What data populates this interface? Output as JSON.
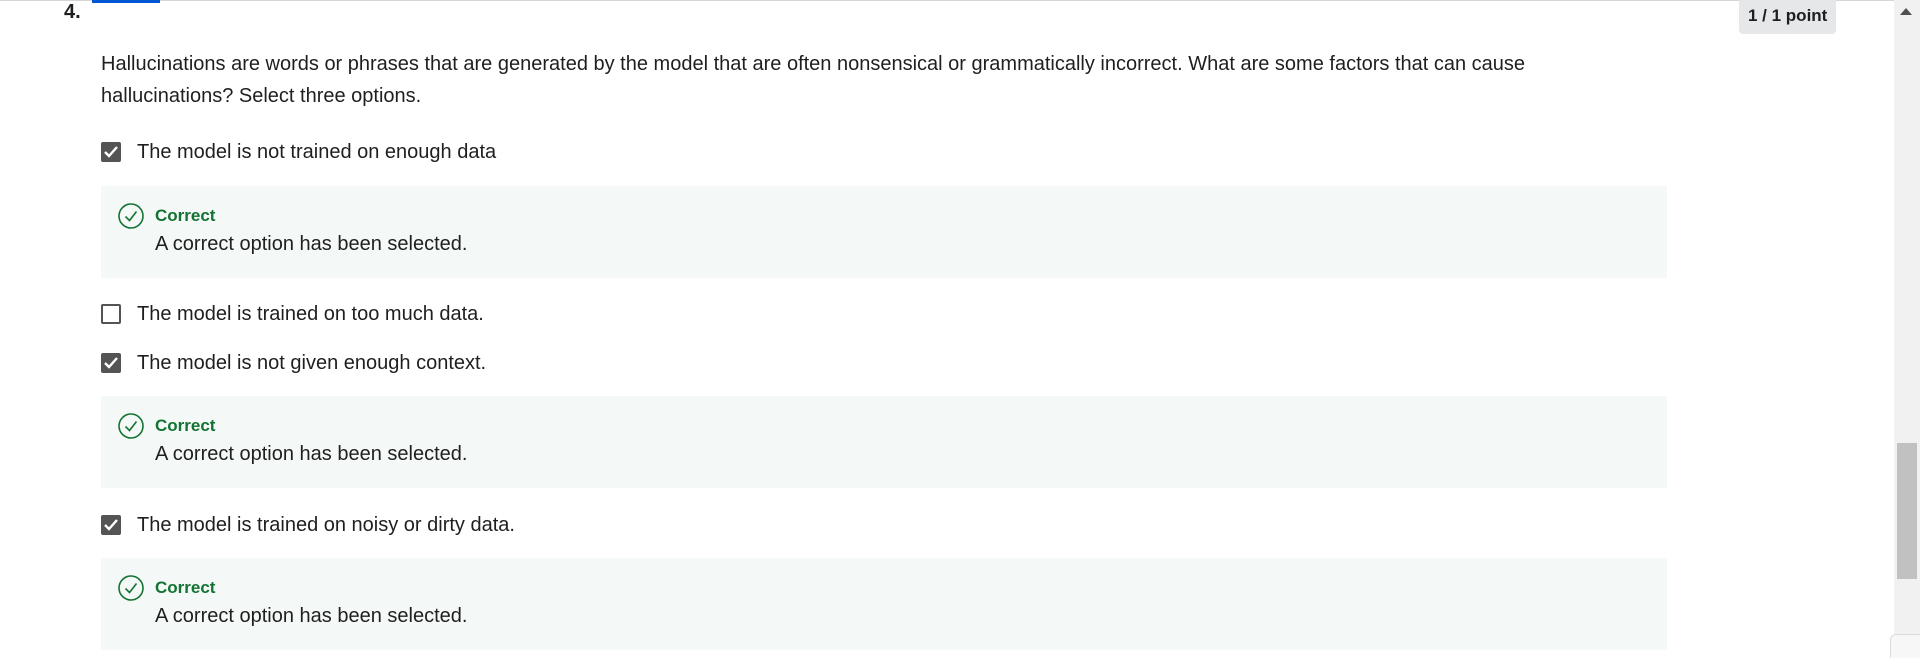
{
  "question": {
    "number": "4.",
    "score": "1 / 1 point",
    "prompt": "Hallucinations are words or phrases that are generated by the model that are often nonsensical or grammatically incorrect. What are some factors that can cause hallucinations? Select three options.",
    "options": [
      {
        "label": "The model is not trained on enough data",
        "checked": true,
        "feedback": {
          "status": "Correct",
          "text": "A correct option has been selected."
        }
      },
      {
        "label": "The model is trained on too much data.",
        "checked": false
      },
      {
        "label": "The model is not given enough context.",
        "checked": true,
        "feedback": {
          "status": "Correct",
          "text": "A correct option has been selected."
        }
      },
      {
        "label": "The model is trained on noisy or dirty data.",
        "checked": true,
        "feedback": {
          "status": "Correct",
          "text": "A correct option has been selected."
        }
      }
    ]
  },
  "colors": {
    "correct": "#137333",
    "checkbox": "#545454",
    "feedback_bg": "#f4f8f6",
    "score_badge_bg": "#e5e7e8"
  },
  "icons": {
    "checkbox_checked": "checkmark",
    "feedback_correct": "check-circle"
  }
}
